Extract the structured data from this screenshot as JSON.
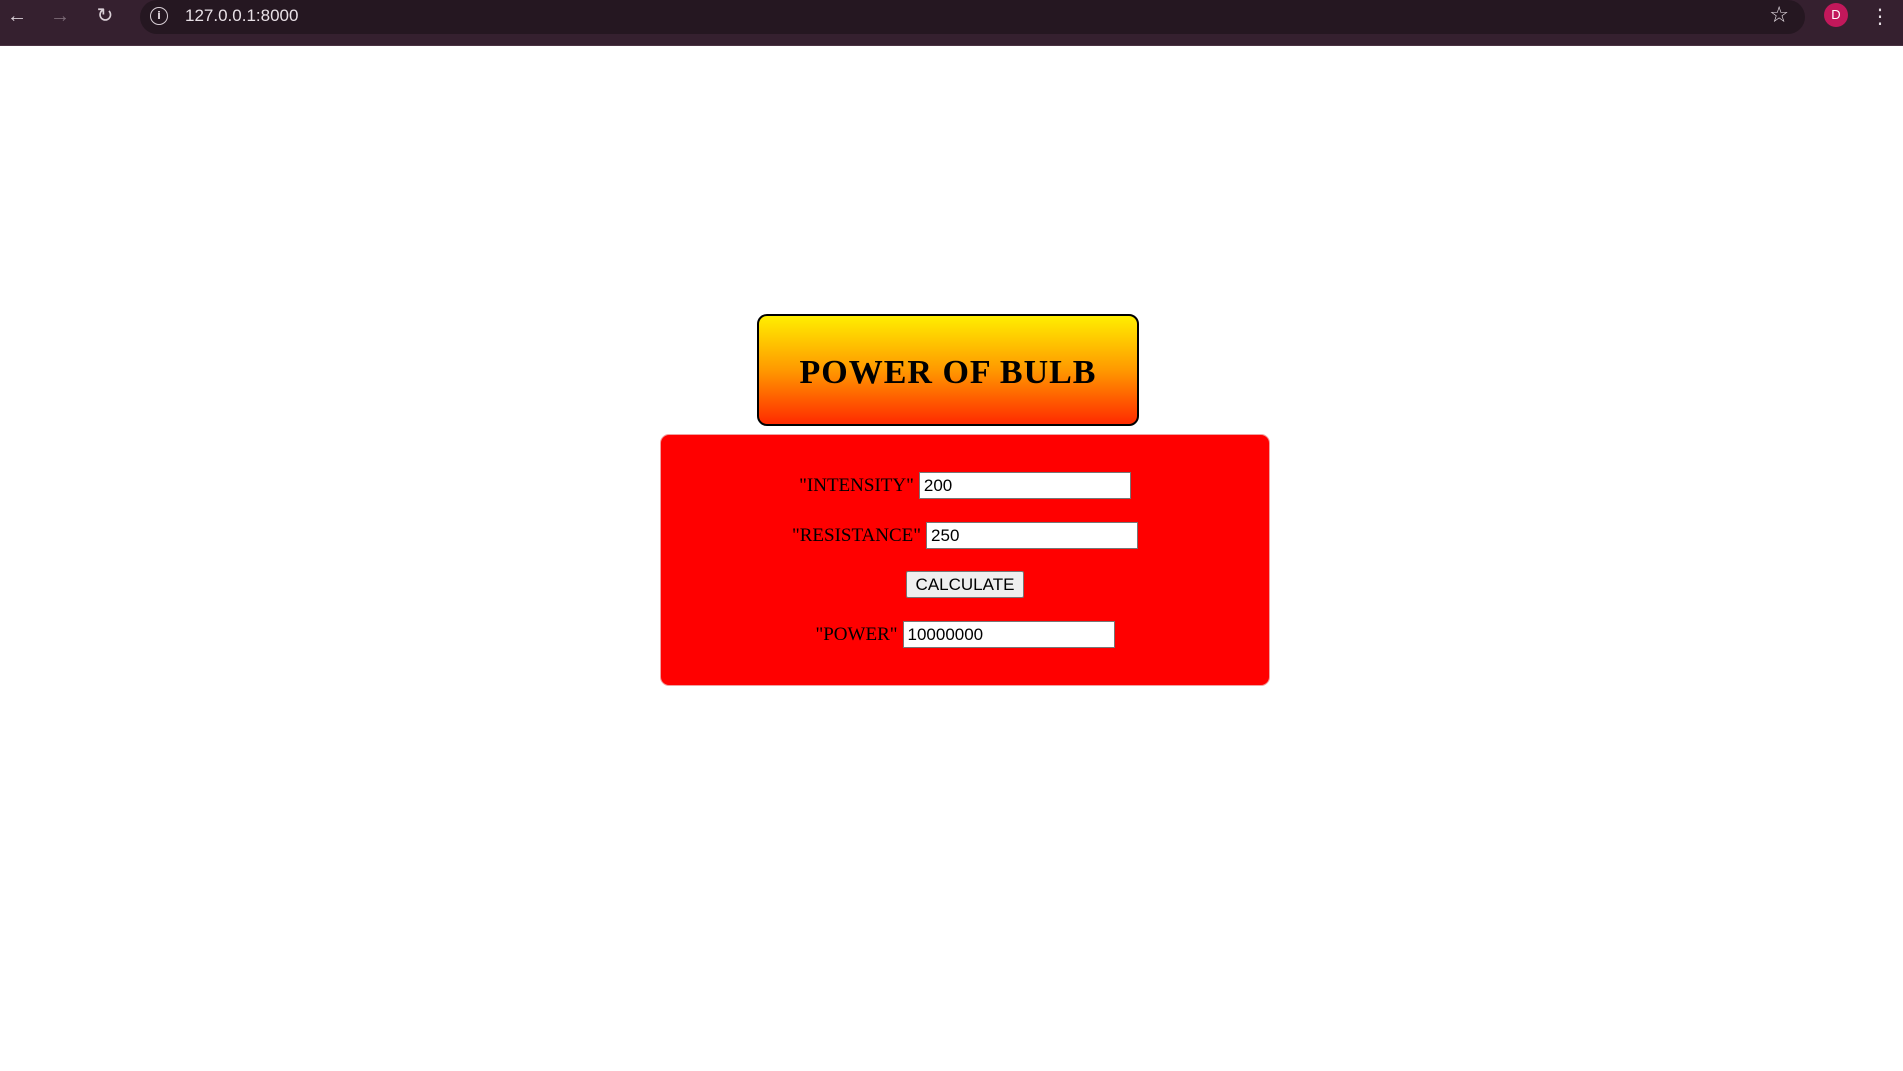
{
  "browser": {
    "url": "127.0.0.1:8000",
    "avatar_initial": "D",
    "back_glyph": "←",
    "forward_glyph": "→",
    "reload_glyph": "↻",
    "info_glyph": "i",
    "star_glyph": "☆",
    "menu_glyph": "⋮"
  },
  "page": {
    "title": "POWER OF BULB",
    "form": {
      "intensity_label": "\"INTENSITY\"",
      "intensity_value": "200",
      "resistance_label": "\"RESISTANCE\"",
      "resistance_value": "250",
      "calculate_label": "CALCULATE",
      "power_label": "\"POWER\"",
      "power_value": "10000000"
    }
  },
  "colors": {
    "browser_bar": "#35202f",
    "form_background": "#ff0000",
    "title_gradient_top": "#ffee00",
    "title_gradient_bottom": "#ff2a00",
    "avatar": "#c2185b"
  }
}
